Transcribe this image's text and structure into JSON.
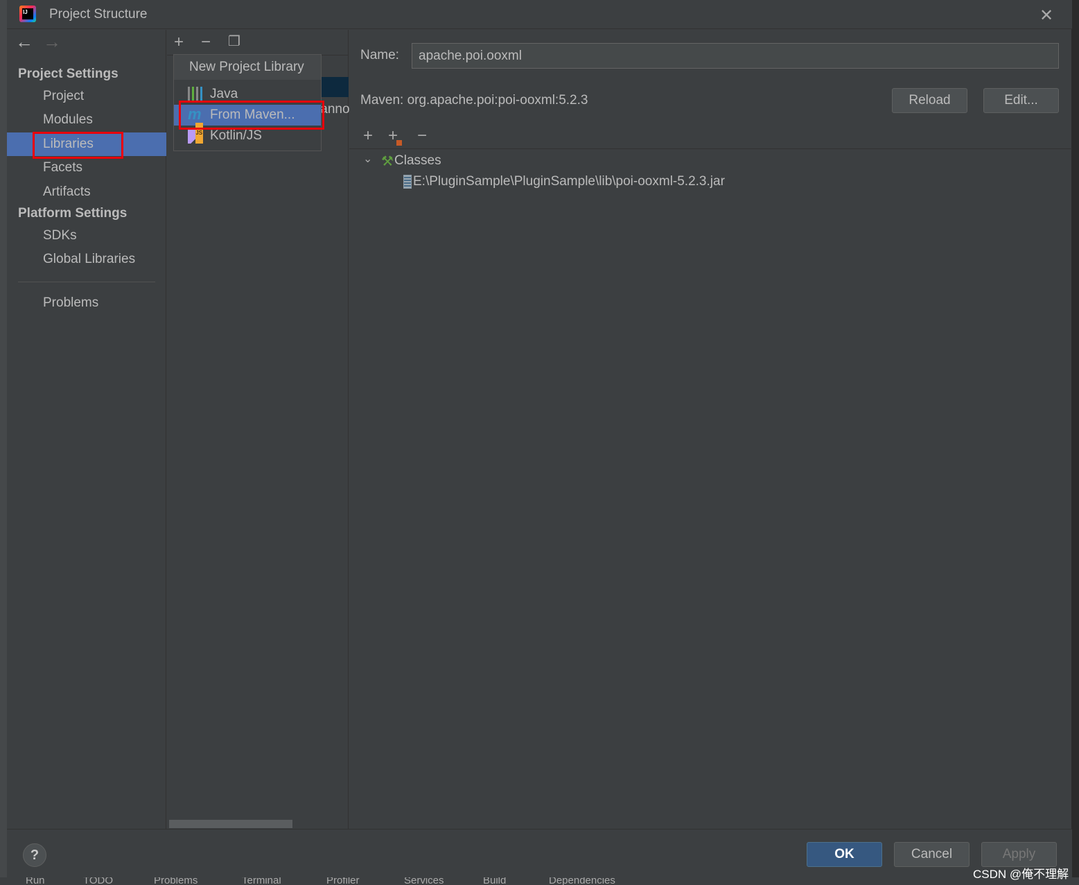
{
  "window": {
    "title": "Project Structure"
  },
  "sidebar": {
    "sections": [
      {
        "label": "Project Settings"
      },
      {
        "label": "Platform Settings"
      }
    ],
    "items": [
      {
        "label": "Project"
      },
      {
        "label": "Modules"
      },
      {
        "label": "Libraries",
        "selected": true
      },
      {
        "label": "Facets"
      },
      {
        "label": "Artifacts"
      },
      {
        "label": "SDKs"
      },
      {
        "label": "Global Libraries"
      },
      {
        "label": "Problems"
      }
    ]
  },
  "list": {
    "partial_item": ":anno"
  },
  "popup": {
    "header": "New Project Library",
    "items": [
      {
        "label": "Java",
        "icon": "library-icon"
      },
      {
        "label": "From Maven...",
        "icon": "maven-icon",
        "selected": true
      },
      {
        "label": "Kotlin/JS",
        "icon": "kotlin-js-icon"
      }
    ]
  },
  "detail": {
    "name_label": "Name:",
    "name_value": "apache.poi.ooxml",
    "maven": "Maven: org.apache.poi:poi-ooxml:5.2.3",
    "reload": "Reload",
    "edit": "Edit...",
    "tree": {
      "root": "Classes",
      "child": "E:\\PluginSample\\PluginSample\\lib\\poi-ooxml-5.2.3.jar"
    }
  },
  "footer": {
    "help": "?",
    "ok": "OK",
    "cancel": "Cancel",
    "apply": "Apply"
  },
  "toolwindows": [
    "Run",
    "TODO",
    "Problems",
    "Terminal",
    "Profiler",
    "Services",
    "Build",
    "Dependencies"
  ],
  "watermark": "CSDN @俺不理解",
  "colors": {
    "selection": "#4b6eaf",
    "highlight_box": "#e8000b",
    "ok_button": "#365880"
  }
}
